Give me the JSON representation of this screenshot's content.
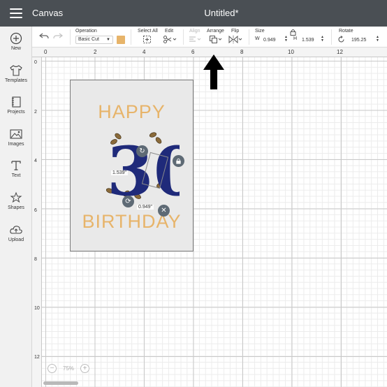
{
  "header": {
    "app_title": "Canvas",
    "doc_title": "Untitled*"
  },
  "sidebar": {
    "items": [
      {
        "label": "New",
        "icon": "plus-circle-icon"
      },
      {
        "label": "Templates",
        "icon": "shirt-icon"
      },
      {
        "label": "Projects",
        "icon": "book-icon"
      },
      {
        "label": "Images",
        "icon": "image-icon"
      },
      {
        "label": "Text",
        "icon": "text-icon"
      },
      {
        "label": "Shapes",
        "icon": "shapes-icon"
      },
      {
        "label": "Upload",
        "icon": "cloud-upload-icon"
      }
    ]
  },
  "toolbar": {
    "operation_label": "Operation",
    "operation_value": "Basic Cut",
    "operation_color": "#e7b46a",
    "select_all_label": "Select All",
    "edit_label": "Edit",
    "align_label": "Align",
    "arrange_label": "Arrange",
    "flip_label": "Flip",
    "size_label": "Size",
    "width_letter": "W",
    "width_value": "0.949",
    "height_letter": "H",
    "height_value": "1.539",
    "rotate_label": "Rotate",
    "rotate_value": "195.25"
  },
  "ruler": {
    "top_ticks": [
      "0",
      "2",
      "4",
      "6",
      "8",
      "10",
      "12"
    ],
    "left_ticks": [
      "0",
      "2",
      "4",
      "6",
      "8",
      "10",
      "12"
    ]
  },
  "card": {
    "line1": "HAPPY",
    "number": "30",
    "line2": "BIRTHDAY",
    "text_color": "#e7b46a",
    "number_color": "#1f2a7a"
  },
  "selection": {
    "height_tag": "1.539\"",
    "width_tag": "0.949\""
  },
  "zoom": {
    "minus": "−",
    "value": "75%",
    "plus": "+"
  }
}
